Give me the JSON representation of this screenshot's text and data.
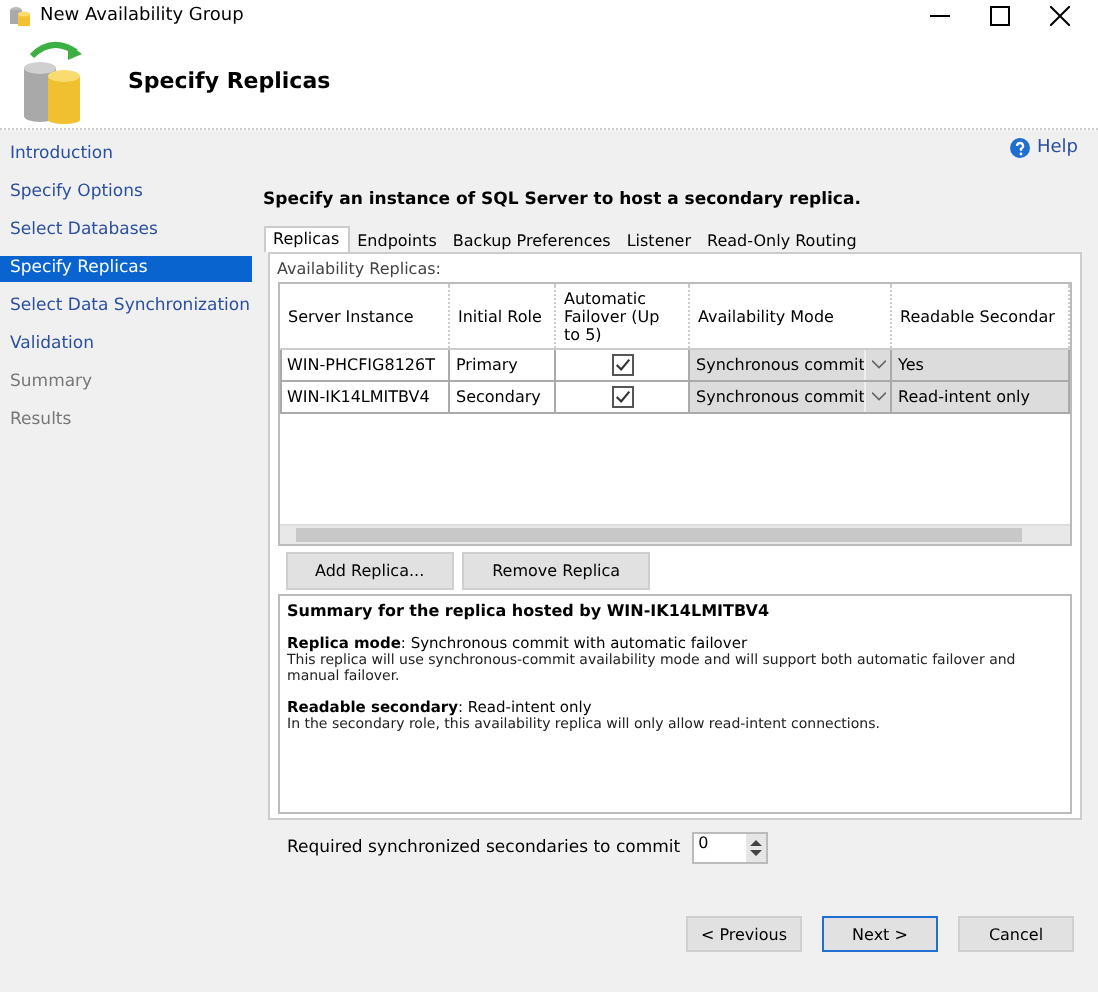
{
  "window": {
    "title": "New Availability Group"
  },
  "header": {
    "title": "Specify Replicas"
  },
  "sidebar": {
    "items": [
      {
        "label": "Introduction",
        "selected": false,
        "disabled": false
      },
      {
        "label": "Specify Options",
        "selected": false,
        "disabled": false
      },
      {
        "label": "Select Databases",
        "selected": false,
        "disabled": false
      },
      {
        "label": "Specify Replicas",
        "selected": true,
        "disabled": false
      },
      {
        "label": "Select Data Synchronization",
        "selected": false,
        "disabled": false
      },
      {
        "label": "Validation",
        "selected": false,
        "disabled": false
      },
      {
        "label": "Summary",
        "selected": false,
        "disabled": true
      },
      {
        "label": "Results",
        "selected": false,
        "disabled": true
      }
    ]
  },
  "help": {
    "label": "Help"
  },
  "instruction": "Specify an instance of SQL Server to host a secondary replica.",
  "tabs": [
    {
      "label": "Replicas",
      "selected": true
    },
    {
      "label": "Endpoints",
      "selected": false
    },
    {
      "label": "Backup Preferences",
      "selected": false
    },
    {
      "label": "Listener",
      "selected": false
    },
    {
      "label": "Read-Only Routing",
      "selected": false
    }
  ],
  "table": {
    "caption": "Availability Replicas:",
    "columns": [
      "Server Instance",
      "Initial Role",
      "Automatic Failover (Up to 5)",
      "Availability Mode",
      "Readable Secondar"
    ],
    "rows": [
      {
        "instance": "WIN-PHCFIG8126T",
        "role": "Primary",
        "failover": true,
        "mode": "Synchronous commit",
        "readable": "Yes"
      },
      {
        "instance": "WIN-IK14LMITBV4",
        "role": "Secondary",
        "failover": true,
        "mode": "Synchronous commit",
        "readable": "Read-intent only"
      }
    ]
  },
  "replica_buttons": [
    "Add Replica...",
    "Remove Replica"
  ],
  "summary": {
    "title": "Summary for the replica hosted by WIN-IK14LMITBV4",
    "sections": [
      {
        "heading": "**Replica mode**: Synchronous commit with automatic failover",
        "detail": "This replica will use synchronous-commit availability mode and will support both automatic failover and manual failover."
      },
      {
        "heading": "**Readable secondary**: Read-intent only",
        "detail": "In the secondary role, this availability replica will only allow read-intent connections."
      }
    ]
  },
  "required": {
    "label": "Required synchronized secondaries to commit",
    "value": "0"
  },
  "footer": [
    {
      "label": "< Previous",
      "default": false
    },
    {
      "label": "Next >",
      "default": true
    },
    {
      "label": "Cancel",
      "default": false
    }
  ]
}
